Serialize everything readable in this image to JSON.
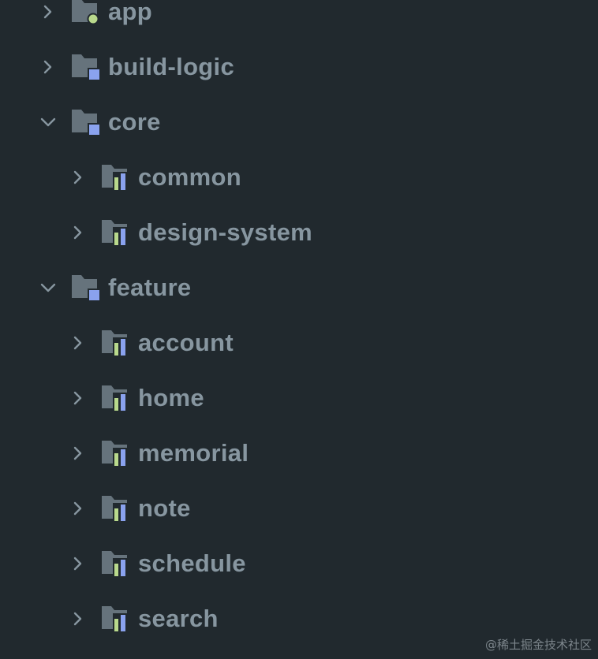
{
  "project_tree": {
    "items": [
      {
        "label": "app",
        "depth": 0,
        "expanded": false,
        "icon": "app-module-folder-icon"
      },
      {
        "label": "build-logic",
        "depth": 0,
        "expanded": false,
        "icon": "module-group-folder-icon"
      },
      {
        "label": "core",
        "depth": 0,
        "expanded": true,
        "icon": "module-group-folder-icon"
      },
      {
        "label": "common",
        "depth": 1,
        "expanded": false,
        "icon": "library-module-folder-icon"
      },
      {
        "label": "design-system",
        "depth": 1,
        "expanded": false,
        "icon": "library-module-folder-icon"
      },
      {
        "label": "feature",
        "depth": 0,
        "expanded": true,
        "icon": "module-group-folder-icon"
      },
      {
        "label": "account",
        "depth": 1,
        "expanded": false,
        "icon": "library-module-folder-icon"
      },
      {
        "label": "home",
        "depth": 1,
        "expanded": false,
        "icon": "library-module-folder-icon"
      },
      {
        "label": "memorial",
        "depth": 1,
        "expanded": false,
        "icon": "library-module-folder-icon"
      },
      {
        "label": "note",
        "depth": 1,
        "expanded": false,
        "icon": "library-module-folder-icon"
      },
      {
        "label": "schedule",
        "depth": 1,
        "expanded": false,
        "icon": "library-module-folder-icon"
      },
      {
        "label": "search",
        "depth": 1,
        "expanded": false,
        "icon": "library-module-folder-icon"
      }
    ]
  },
  "watermark": "@稀土掘金技术社区",
  "colors": {
    "background": "#21292e",
    "label": "#8796a0",
    "folder": "#66737c",
    "app_badge": "#b9d98c",
    "group_badge": "#8aa2ee",
    "library_bar_green": "#b9d98c",
    "library_bar_blue": "#8aa2ee"
  }
}
